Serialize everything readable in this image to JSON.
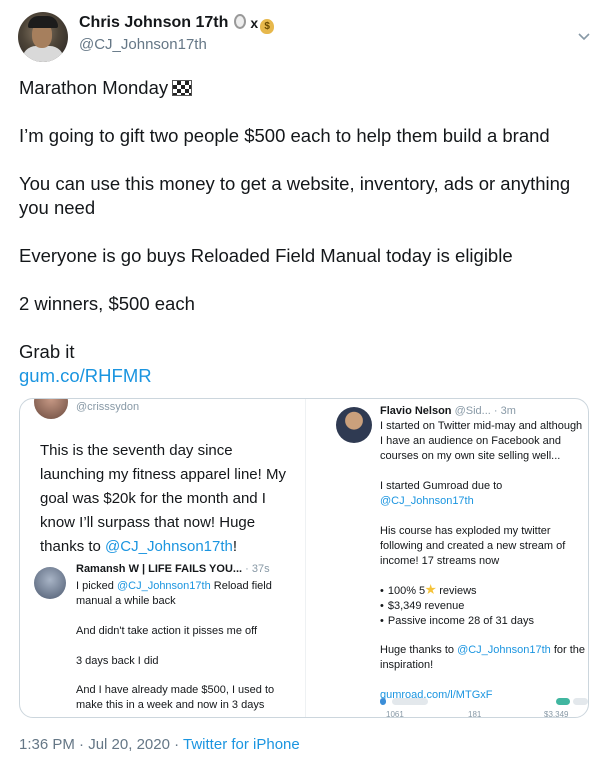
{
  "author": {
    "name": "Chris Johnson 17th",
    "name_suffix": "x",
    "handle": "@CJ_Johnson17th"
  },
  "tweet": {
    "lines": [
      "Marathon Monday",
      "I’m going to gift two people $500 each to help them build a brand",
      "You can use this money to get a website, inventory, ads or anything you need",
      "Everyone is go buys Reloaded Field Manual today is eligible",
      "2 winners, $500 each",
      "Grab it"
    ],
    "link": "gum.co/RHFMR"
  },
  "media": {
    "left": {
      "handle": "@crisssydon",
      "main_text_before": "This is the seventh day since launching my fitness apparel line! My goal was $20k for the month and I know I’ll surpass that now! Huge thanks to ",
      "main_mention": "@CJ_Johnson17th",
      "main_text_after": "!",
      "reply": {
        "name": "Ramansh W | LIFE FAILS YOU...",
        "time": "· 37s",
        "line1_before": "I picked ",
        "line1_mention": "@CJ_Johnson17th",
        "line1_after": " Reload field manual a while back",
        "line2": "And didn't take action it pisses me off",
        "line3": "3 days back I did",
        "line4": "And I have already made $500, I used to make this in a week and now in 3 days"
      }
    },
    "right": {
      "name": "Flavio Nelson",
      "meta": "@Sid... · 3m",
      "intro": "I started on Twitter mid-may and although I have an audience on Facebook and courses on my own site selling well...",
      "gumroad_before": "I started Gumroad due to ",
      "gumroad_mention": "@CJ_Johnson17th",
      "growth": "His course has exploded my twitter following and created a new stream of income! 17 streams now",
      "bullet1_before": "100% 5",
      "bullet1_after": " reviews",
      "bullet2": "$3,349 revenue",
      "bullet3": "Passive income 28 of 31 days",
      "thanks_before": "Huge thanks to ",
      "thanks_mention": "@CJ_Johnson17th",
      "thanks_after": " for the inspiration!",
      "link": "gumroad.com/l/MTGxF",
      "chart_figures": [
        "1061",
        "181",
        "$3,349"
      ]
    }
  },
  "footer": {
    "time": "1:36 PM",
    "separator1": " · ",
    "date": "Jul 20, 2020",
    "separator2": " · ",
    "source": "Twitter for iPhone"
  },
  "colors": {
    "link": "#1b95e0",
    "text": "#14171a",
    "muted": "#657786",
    "border": "#ccd6dd"
  }
}
